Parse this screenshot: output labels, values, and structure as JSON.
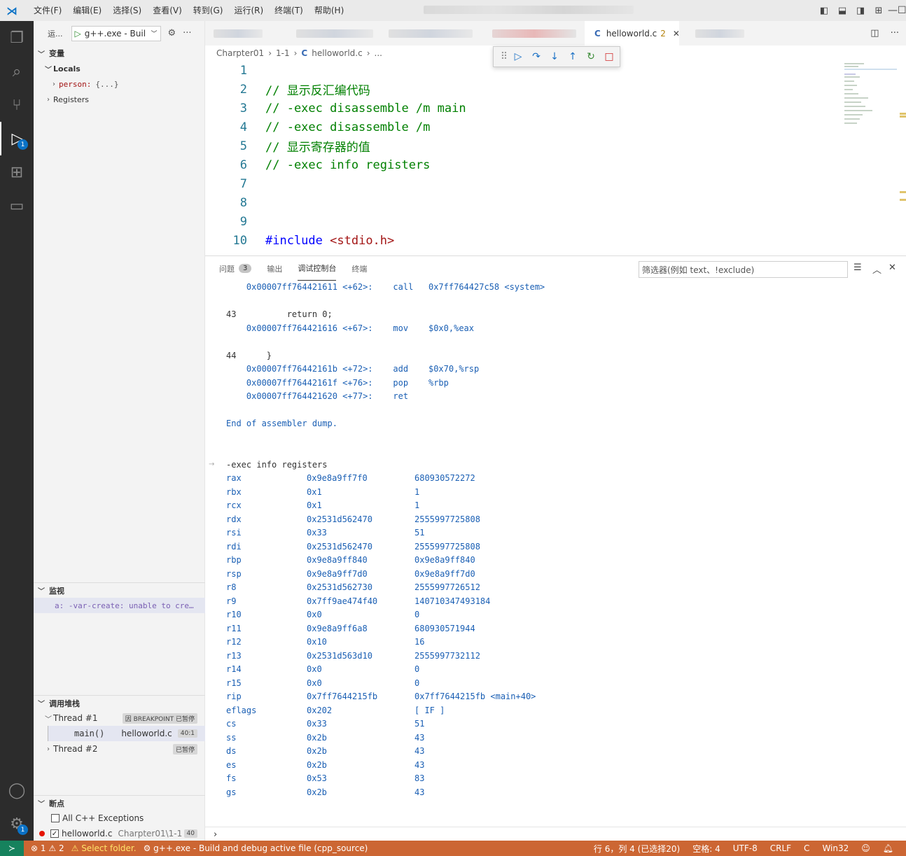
{
  "titlebar": {
    "menus": [
      "文件(F)",
      "编辑(E)",
      "选择(S)",
      "查看(V)",
      "转到(G)",
      "运行(R)",
      "终端(T)",
      "帮助(H)"
    ]
  },
  "activity": {
    "debug_badge": "1",
    "settings_badge": "1"
  },
  "sidebar": {
    "run_label": "运...",
    "config_name": "g++.exe - Buil",
    "variables_title": "变量",
    "locals_label": "Locals",
    "person_name": "person:",
    "person_value": "{...}",
    "registers_label": "Registers",
    "watch_title": "监视",
    "watch_item": "a: -var-create: unable to cre…",
    "callstack_title": "调用堆栈",
    "thread1": "Thread #1",
    "thread1_status": "因 BREAKPOINT 已暂停",
    "frame_func": "main()",
    "frame_file": "helloworld.c",
    "frame_pos": "40:1",
    "thread2": "Thread #2",
    "thread2_status": "已暂停",
    "breakpoints_title": "断点",
    "bp_exceptions": "All C++ Exceptions",
    "bp_file": "helloworld.c",
    "bp_path": "Charpter01\\1-1",
    "bp_line": "40"
  },
  "tabs": {
    "active_name": "helloworld.c",
    "active_problems": "2"
  },
  "breadcrumb": {
    "parts": [
      "Charpter01",
      "1-1",
      "helloworld.c",
      "..."
    ]
  },
  "code": {
    "lines": [
      {
        "n": "1",
        "t": ""
      },
      {
        "n": "2",
        "t": "// 显示反汇编代码"
      },
      {
        "n": "3",
        "t": "// -exec disassemble /m main"
      },
      {
        "n": "4",
        "t": "// -exec disassemble /m"
      },
      {
        "n": "5",
        "t": "// 显示寄存器的值"
      },
      {
        "n": "6",
        "t": "// -exec info registers"
      },
      {
        "n": "7",
        "t": ""
      },
      {
        "n": "8",
        "t": ""
      },
      {
        "n": "9",
        "t": ""
      },
      {
        "n": "10",
        "t": "<stdio.h>"
      }
    ],
    "include_kw": "#include"
  },
  "panel": {
    "tab_problems": "问题",
    "problems_count": "3",
    "tab_output": "输出",
    "tab_debug_console": "调试控制台",
    "tab_terminal": "终端",
    "filter_placeholder": "筛选器(例如 text、!exclude)",
    "asm": [
      "    0x00007ff764421611 <+62>:    call   0x7ff764427c58 <system>",
      "",
      "43          return 0;",
      "    0x00007ff764421616 <+67>:    mov    $0x0,%eax",
      "",
      "44      }",
      "    0x00007ff76442161b <+72>:    add    $0x70,%rsp",
      "    0x00007ff76442161f <+76>:    pop    %rbp",
      "    0x00007ff764421620 <+77>:    ret",
      "",
      "End of assembler dump."
    ],
    "command": "-exec info registers",
    "registers": [
      {
        "name": "rax",
        "hex": "0x9e8a9ff7f0",
        "val": "680930572272"
      },
      {
        "name": "rbx",
        "hex": "0x1",
        "val": "1"
      },
      {
        "name": "rcx",
        "hex": "0x1",
        "val": "1"
      },
      {
        "name": "rdx",
        "hex": "0x2531d562470",
        "val": "2555997725808"
      },
      {
        "name": "rsi",
        "hex": "0x33",
        "val": "51"
      },
      {
        "name": "rdi",
        "hex": "0x2531d562470",
        "val": "2555997725808"
      },
      {
        "name": "rbp",
        "hex": "0x9e8a9ff840",
        "val": "0x9e8a9ff840"
      },
      {
        "name": "rsp",
        "hex": "0x9e8a9ff7d0",
        "val": "0x9e8a9ff7d0"
      },
      {
        "name": "r8",
        "hex": "0x2531d562730",
        "val": "2555997726512"
      },
      {
        "name": "r9",
        "hex": "0x7ff9ae474f40",
        "val": "140710347493184"
      },
      {
        "name": "r10",
        "hex": "0x0",
        "val": "0"
      },
      {
        "name": "r11",
        "hex": "0x9e8a9ff6a8",
        "val": "680930571944"
      },
      {
        "name": "r12",
        "hex": "0x10",
        "val": "16"
      },
      {
        "name": "r13",
        "hex": "0x2531d563d10",
        "val": "2555997732112"
      },
      {
        "name": "r14",
        "hex": "0x0",
        "val": "0"
      },
      {
        "name": "r15",
        "hex": "0x0",
        "val": "0"
      },
      {
        "name": "rip",
        "hex": "0x7ff7644215fb",
        "val": "0x7ff7644215fb <main+40>"
      },
      {
        "name": "eflags",
        "hex": "0x202",
        "val": "[ IF ]"
      },
      {
        "name": "cs",
        "hex": "0x33",
        "val": "51"
      },
      {
        "name": "ss",
        "hex": "0x2b",
        "val": "43"
      },
      {
        "name": "ds",
        "hex": "0x2b",
        "val": "43"
      },
      {
        "name": "es",
        "hex": "0x2b",
        "val": "43"
      },
      {
        "name": "fs",
        "hex": "0x53",
        "val": "83"
      },
      {
        "name": "gs",
        "hex": "0x2b",
        "val": "43"
      }
    ]
  },
  "statusbar": {
    "errors": "1",
    "warnings": "2",
    "select_folder": "Select folder.",
    "launch": "g++.exe - Build and debug active file (cpp_source)",
    "position": "行 6，列 4 (已选择20)",
    "spaces": "空格: 4",
    "encoding": "UTF-8",
    "eol": "CRLF",
    "language": "C",
    "platform": "Win32",
    "colors": {
      "bg": "#cc6633",
      "remote": "#16825d"
    }
  }
}
